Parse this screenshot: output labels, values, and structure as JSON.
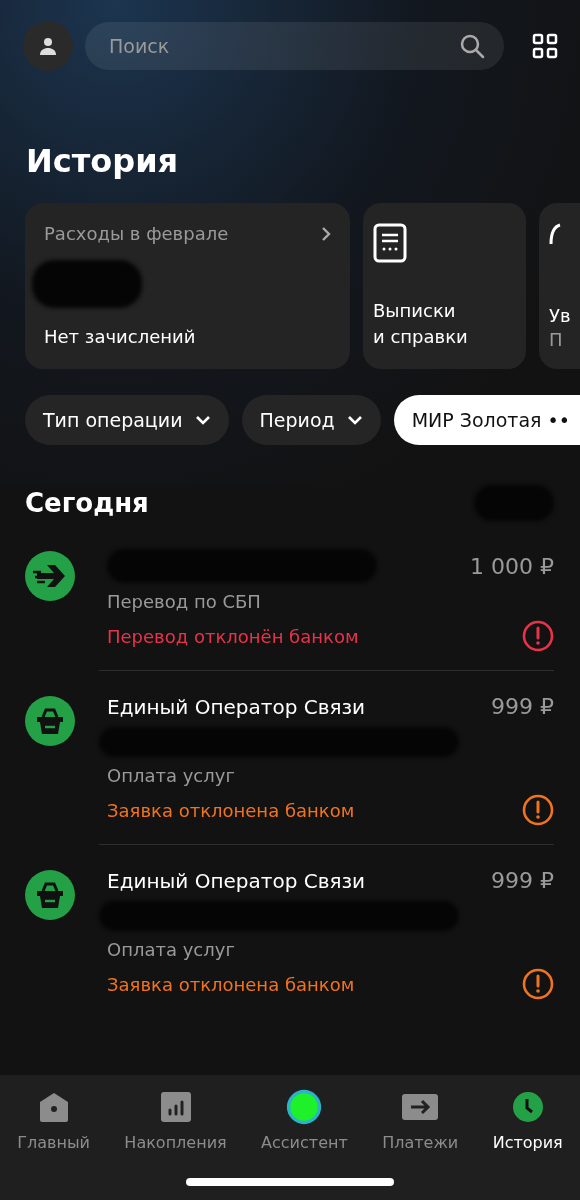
{
  "header": {
    "search": {
      "placeholder": "Поиск"
    }
  },
  "title": "История",
  "cards": [
    {
      "kind": "summary",
      "title": "Расходы в феврале",
      "subtitle": "Нет зачислений"
    },
    {
      "kind": "link",
      "title": "Выписки\nи справки"
    },
    {
      "kind": "link",
      "title": "Ув",
      "subtitle": "П"
    }
  ],
  "filters": [
    {
      "kind": "dropdown",
      "label": "Тип операции",
      "selected": false
    },
    {
      "kind": "dropdown",
      "label": "Период",
      "selected": false
    },
    {
      "kind": "card",
      "label": "МИР Золотая ••",
      "selected": true
    }
  ],
  "section": {
    "title": "Сегодня"
  },
  "transactions": [
    {
      "kind": "transfer",
      "amount": "1 000 ₽",
      "category": "Перевод по СБП",
      "status": {
        "text": "Перевод отклонён банком",
        "color": "#e8324a"
      }
    },
    {
      "kind": "purchase",
      "name": "Единый Оператор Связи",
      "amount": "999 ₽",
      "category": "Оплата услуг",
      "status": {
        "text": "Заявка отклонена банком",
        "color": "#f0731e"
      }
    },
    {
      "kind": "purchase",
      "name": "Единый Оператор Связи",
      "amount": "999 ₽",
      "category": "Оплата услуг",
      "status": {
        "text": "Заявка отклонена банком",
        "color": "#f0731e"
      }
    }
  ],
  "nav": [
    {
      "kind": "home",
      "label": "Главный",
      "selected": false
    },
    {
      "kind": "savings",
      "label": "Накопления",
      "selected": false
    },
    {
      "kind": "assistant",
      "label": "Ассистент",
      "selected": false
    },
    {
      "kind": "payments",
      "label": "Платежи",
      "selected": false
    },
    {
      "kind": "history",
      "label": "История",
      "selected": true
    }
  ]
}
